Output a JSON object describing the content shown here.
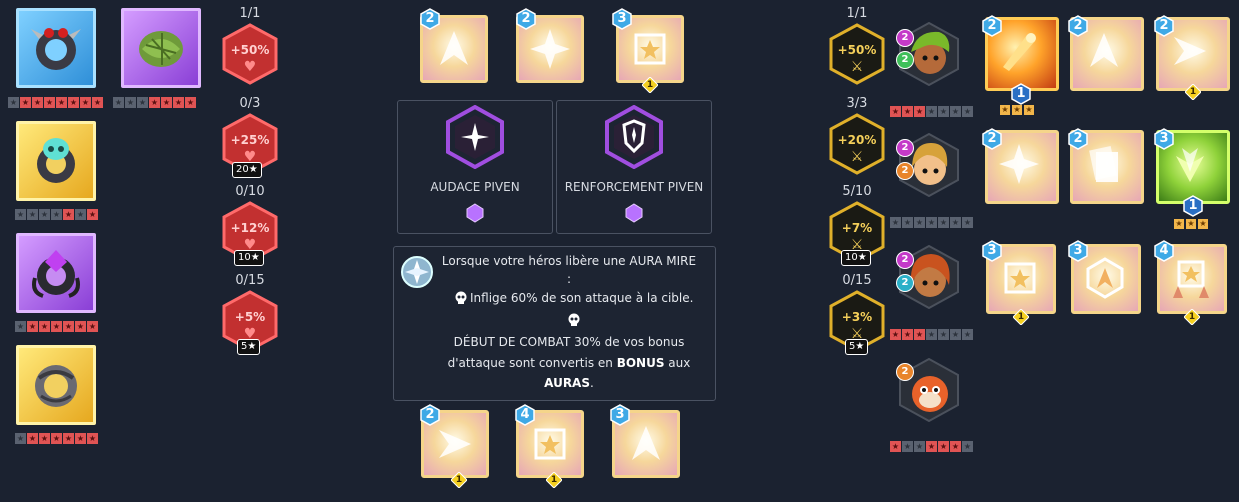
{
  "colors": {
    "background": "#1b2230",
    "red_stat": "#e04848",
    "gold_stat": "#f0c23c",
    "star_on": "#e05454",
    "star_off": "#5a6270"
  },
  "left_items": [
    {
      "icon": "spiked-ring-icon",
      "frame": "blue"
    },
    {
      "icon": "leaf-amulet-icon",
      "frame": "purple"
    },
    {
      "icon": "skull-ring-icon",
      "frame": "gold"
    },
    {
      "icon": "purple-gem-ring-icon",
      "frame": "purple"
    },
    {
      "icon": "engraved-ring-icon",
      "frame": "gold"
    }
  ],
  "red_stats": [
    {
      "count": "1/1",
      "value": "+50%",
      "req": ""
    },
    {
      "count": "0/3",
      "value": "+25%",
      "req": "20★"
    },
    {
      "count": "0/10",
      "value": "+12%",
      "req": "10★"
    },
    {
      "count": "0/15",
      "value": "+5%",
      "req": "5★"
    }
  ],
  "talents": {
    "left_title": "AUDACE PIVEN",
    "right_title": "RENFORCEMENT PIVEN"
  },
  "description": {
    "line1": "Lorsque votre héros libère une AURA MIRE",
    "line2": ":",
    "line3": "Inflige 60% de son attaque à la cible.",
    "line4": "DÉBUT DE COMBAT 30% de vos bonus",
    "line5a": "d'attaque sont convertis en ",
    "line5b": "BONUS",
    "line5c": " aux",
    "line6a": "AURAS",
    "line6b": "."
  },
  "top_cards": [
    {
      "badge": "2"
    },
    {
      "badge": "2"
    },
    {
      "badge": "3",
      "sub": "1"
    }
  ],
  "bottom_cards": [
    {
      "badge": "2",
      "sub": "1"
    },
    {
      "badge": "4",
      "sub": "1"
    },
    {
      "badge": "3"
    }
  ],
  "gold_stats": [
    {
      "count": "1/1",
      "value": "+50%",
      "req": ""
    },
    {
      "count": "3/3",
      "value": "+20%",
      "req": ""
    },
    {
      "count": "5/10",
      "value": "+7%",
      "req": "10★"
    },
    {
      "count": "0/15",
      "value": "+3%",
      "req": "5★"
    }
  ],
  "heroes": [
    {
      "badge_top": "2",
      "badge_bottom": "2",
      "bottom_color": "#3fbf5a",
      "skin": "#b56a3a",
      "hair": "#7ab92a"
    },
    {
      "badge_top": "2",
      "badge_bottom": "2",
      "bottom_color": "#e8842a",
      "skin": "#f2c08a",
      "hair": "#d7a23a"
    },
    {
      "badge_top": "2",
      "badge_bottom": "2",
      "bottom_color": "#2ab0c8",
      "skin": "#c27a44",
      "hair": "#c9531f"
    },
    {
      "badge_top": "2",
      "badge_bottom": "",
      "bottom_color": "",
      "skin": "#e8622a",
      "hair": "#c43a1a"
    }
  ],
  "right_cards": [
    [
      {
        "badge": "2",
        "sub": "1",
        "gold": "3",
        "style": "orange"
      },
      {
        "badge": "2"
      },
      {
        "badge": "2",
        "sub": "1"
      }
    ],
    [
      {
        "badge": "2"
      },
      {
        "badge": "2"
      },
      {
        "badge": "3",
        "sub": "1",
        "gold": "3",
        "style": "green"
      }
    ],
    [
      {
        "badge": "3",
        "sub": "1"
      },
      {
        "badge": "3"
      },
      {
        "badge": "4",
        "sub": "1"
      }
    ]
  ]
}
